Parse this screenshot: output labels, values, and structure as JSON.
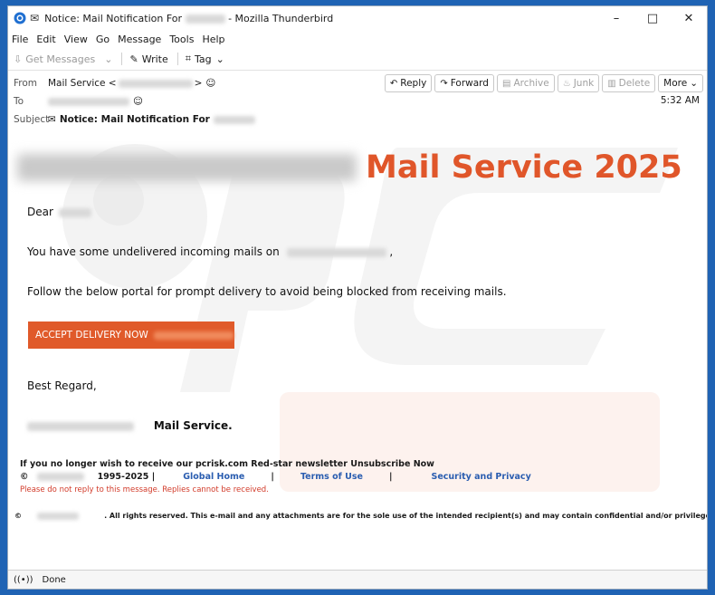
{
  "window": {
    "title_prefix": "Notice: Mail Notification For",
    "title_suffix": "- Mozilla Thunderbird",
    "controls": [
      "–",
      "□",
      "✕"
    ]
  },
  "menu": [
    "File",
    "Edit",
    "View",
    "Go",
    "Message",
    "Tools",
    "Help"
  ],
  "toolbar": {
    "get_messages": "Get Messages",
    "write": "Write",
    "tag": "Tag"
  },
  "header": {
    "from_label": "From",
    "from_name": "Mail Service <",
    "from_end": ">",
    "to_label": "To",
    "subject_label": "Subject",
    "subject_text": "Notice: Mail Notification For",
    "time": "5:32 AM",
    "actions": {
      "reply": "Reply",
      "forward": "Forward",
      "archive": "Archive",
      "junk": "Junk",
      "delete": "Delete",
      "more": "More"
    }
  },
  "email": {
    "brand_title": "Mail Service 2025",
    "greeting": "Dear",
    "line1": "You have some undelivered incoming mails on",
    "line1_end": ",",
    "line2": "Follow the below portal for prompt delivery to avoid being blocked from receiving mails.",
    "button": "ACCEPT DELIVERY NOW",
    "regards": "Best Regard,",
    "signature": "Mail Service.",
    "unsubscribe": "If you no longer wish to receive our pcrisk.com Red-star newsletter Unsubscribe Now",
    "copyright_symbol": "©",
    "years": "1995-2025 |",
    "global_home": "Global Home",
    "sep": "|",
    "terms": "Terms of Use",
    "privacy": "Security and Privacy",
    "noreply": "Please do not reply to this message. Replies cannot be received.",
    "rights": ". All rights reserved. This e-mail and any attachments are for the sole use of the intended recipient(s) and may contain confidential and/or privileged material."
  },
  "status": {
    "text": "Done"
  },
  "colors": {
    "accent": "#e0562a",
    "link": "#2a5db0",
    "warning": "#d23b2a"
  }
}
